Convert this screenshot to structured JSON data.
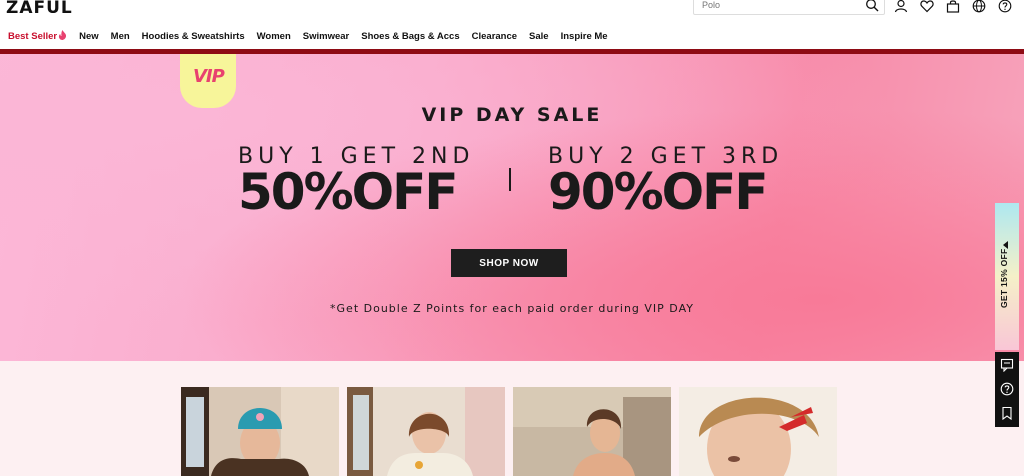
{
  "header": {
    "logo": "ZAFUL",
    "search": {
      "placeholder": "Polo"
    },
    "icons": [
      "search-icon",
      "user-icon",
      "heart-icon",
      "bag-icon",
      "globe-icon",
      "help-icon"
    ]
  },
  "nav": {
    "items": [
      {
        "label": "Best Seller",
        "hot": true
      },
      {
        "label": "New"
      },
      {
        "label": "Men"
      },
      {
        "label": "Hoodies & Sweatshirts"
      },
      {
        "label": "Women"
      },
      {
        "label": "Swimwear"
      },
      {
        "label": "Shoes & Bags & Accs"
      },
      {
        "label": "Clearance"
      },
      {
        "label": "Sale"
      },
      {
        "label": "Inspire Me"
      }
    ],
    "hot_color": "#c8102e"
  },
  "banner": {
    "badge": "VIP",
    "title": "VIP DAY SALE",
    "offer_left": {
      "line1": "BUY 1 GET 2ND",
      "line2": "50%OFF"
    },
    "offer_right": {
      "line1": "BUY 2 GET 3RD",
      "line2": "90%OFF"
    },
    "cta": "SHOP NOW",
    "note": "*Get Double Z Points for each paid order during VIP DAY",
    "accent": "#f78aa8"
  },
  "side": {
    "tab_label": "GET 15% OFF",
    "panel_icons": [
      "chat-icon",
      "help-icon",
      "bookmark-icon"
    ]
  },
  "products": [
    {
      "image": "model-teal-beanie"
    },
    {
      "image": "model-cream-sweater"
    },
    {
      "image": "model-swimwear"
    },
    {
      "image": "model-red-hairclip"
    }
  ]
}
